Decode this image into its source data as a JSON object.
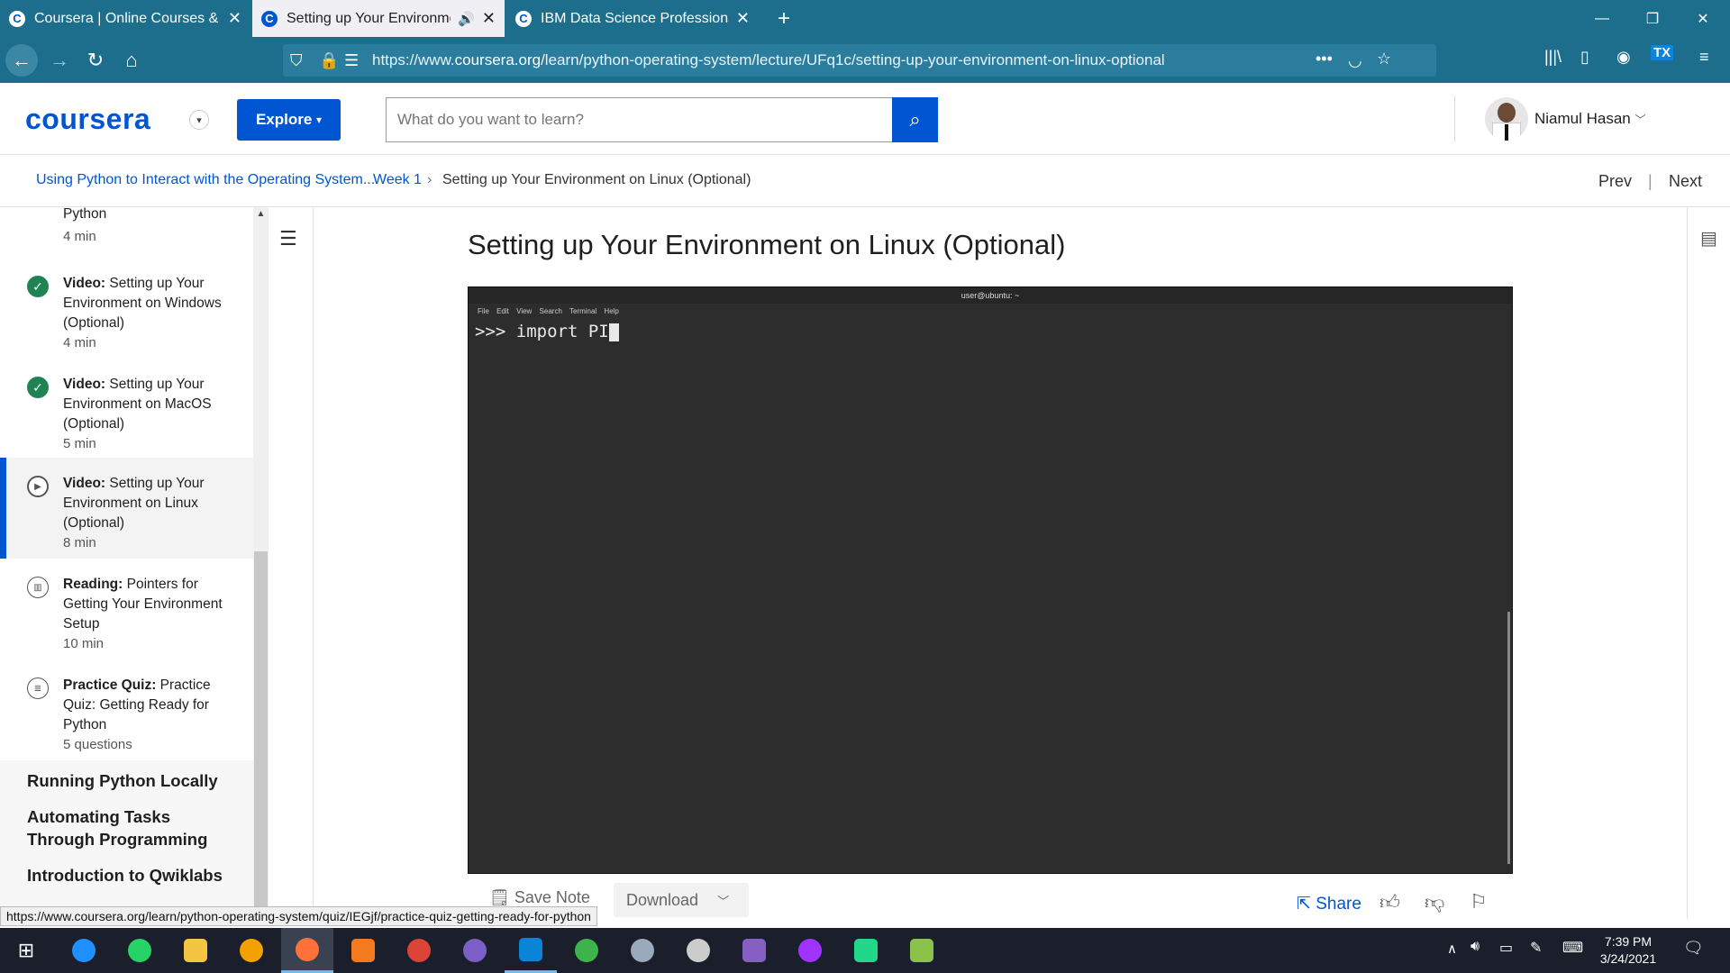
{
  "browser": {
    "tabs": [
      {
        "title": "Coursera | Online Courses & Cr"
      },
      {
        "title": "Setting up Your Environmen"
      },
      {
        "title": "IBM Data Science Professional"
      }
    ],
    "url_prefix": "https://www.",
    "url_domain": "coursera.org",
    "url_path": "/learn/python-operating-system/lecture/UFq1c/setting-up-your-environment-on-linux-optional",
    "new_tab": "+"
  },
  "header": {
    "logo": "coursera",
    "explore": "Explore",
    "search_placeholder": "What do you want to learn?",
    "user": "Niamul Hasan"
  },
  "breadcrumb": {
    "course": "Using Python to Interact with the Operating System...",
    "week": "Week 1",
    "sep": "›",
    "current": "Setting up Your Environment on Linux (Optional)",
    "prev": "Prev",
    "divider": "|",
    "next": "Next"
  },
  "sidebar": {
    "items": [
      {
        "kind": "",
        "title": "Python",
        "meta": "4 min"
      },
      {
        "kind": "Video:",
        "title": " Setting up Your Environment on Windows (Optional)",
        "meta": "4 min"
      },
      {
        "kind": "Video:",
        "title": " Setting up Your Environment on MacOS (Optional)",
        "meta": "5 min"
      },
      {
        "kind": "Video:",
        "title": " Setting up Your Environment on Linux (Optional)",
        "meta": "8 min"
      },
      {
        "kind": "Reading:",
        "title": " Pointers for Getting Your Environment Setup",
        "meta": "10 min"
      },
      {
        "kind": "Practice Quiz:",
        "title": " Practice Quiz: Getting Ready for Python",
        "meta": "5 questions"
      }
    ],
    "sections": [
      "Running Python Locally",
      "Automating Tasks Through Programming",
      "Introduction to Qwiklabs"
    ]
  },
  "main": {
    "title": "Setting up Your Environment on Linux (Optional)",
    "terminal_title": "user@ubuntu: ~",
    "terminal_menu": "File Edit View Search Terminal Help",
    "terminal_line": ">>> import PI",
    "save_note": "Save Note",
    "download": "Download",
    "share": "Share"
  },
  "status_link": "https://www.coursera.org/learn/python-operating-system/quiz/IEGjf/practice-quiz-getting-ready-for-python",
  "taskbar": {
    "time": "7:39 PM",
    "date": "3/24/2021"
  },
  "colors": {
    "browser_chrome": "#1d6e8c",
    "coursera_blue": "#0056d2",
    "complete_green": "#1f8354",
    "taskbar": "#1a1f2b"
  }
}
